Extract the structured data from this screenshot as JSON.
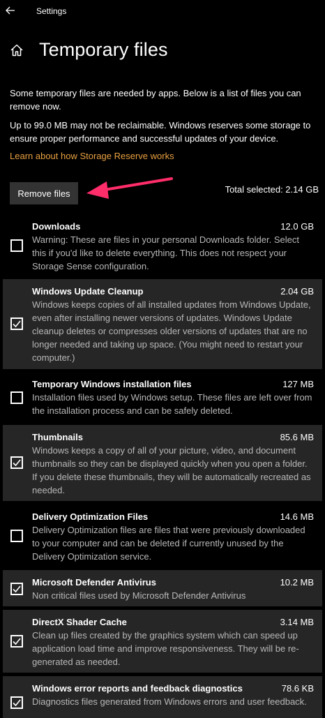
{
  "app": {
    "title": "Settings"
  },
  "page": {
    "title": "Temporary files",
    "intro": "Some temporary files are needed by apps. Below is a list of files you can remove now.",
    "reserve_note": "Up to 99.0 MB may not be reclaimable. Windows reserves some storage to ensure proper performance and successful updates of your device.",
    "learn_link": "Learn about how Storage Reserve works"
  },
  "actions": {
    "remove_label": "Remove files",
    "total_selected": "Total selected: 2.14 GB"
  },
  "colors": {
    "link": "#e8a040",
    "annotation_arrow": "#ff2d6a",
    "checked_row_bg": "#262626"
  },
  "items": [
    {
      "title": "Downloads",
      "size": "12.0 GB",
      "checked": false,
      "desc": "Warning: These are files in your personal Downloads folder. Select this if you'd like to delete everything. This does not respect your Storage Sense configuration."
    },
    {
      "title": "Windows Update Cleanup",
      "size": "2.04 GB",
      "checked": true,
      "desc": "Windows keeps copies of all installed updates from Windows Update, even after installing newer versions of updates. Windows Update cleanup deletes or compresses older versions of updates that are no longer needed and taking up space. (You might need to restart your computer.)"
    },
    {
      "title": "Temporary Windows installation files",
      "size": "127 MB",
      "checked": false,
      "desc": "Installation files used by Windows setup.  These files are left over from the installation process and can be safely deleted."
    },
    {
      "title": "Thumbnails",
      "size": "85.6 MB",
      "checked": true,
      "desc": "Windows keeps a copy of all of your picture, video, and document thumbnails so they can be displayed quickly when you open a folder. If you delete these thumbnails, they will be automatically recreated as needed."
    },
    {
      "title": "Delivery Optimization Files",
      "size": "14.6 MB",
      "checked": false,
      "desc": "Delivery Optimization files are files that were previously downloaded to your computer and can be deleted if currently unused by the Delivery Optimization service."
    },
    {
      "title": "Microsoft Defender Antivirus",
      "size": "10.2 MB",
      "checked": true,
      "desc": "Non critical files used by Microsoft Defender Antivirus"
    },
    {
      "title": "DirectX Shader Cache",
      "size": "3.14 MB",
      "checked": true,
      "desc": "Clean up files created by the graphics system which can speed up application load time and improve responsiveness. They will be re-generated as needed."
    },
    {
      "title": "Windows error reports and feedback diagnostics",
      "size": "78.6 KB",
      "checked": true,
      "desc": "Diagnostics files generated from Windows errors and user feedback."
    }
  ]
}
